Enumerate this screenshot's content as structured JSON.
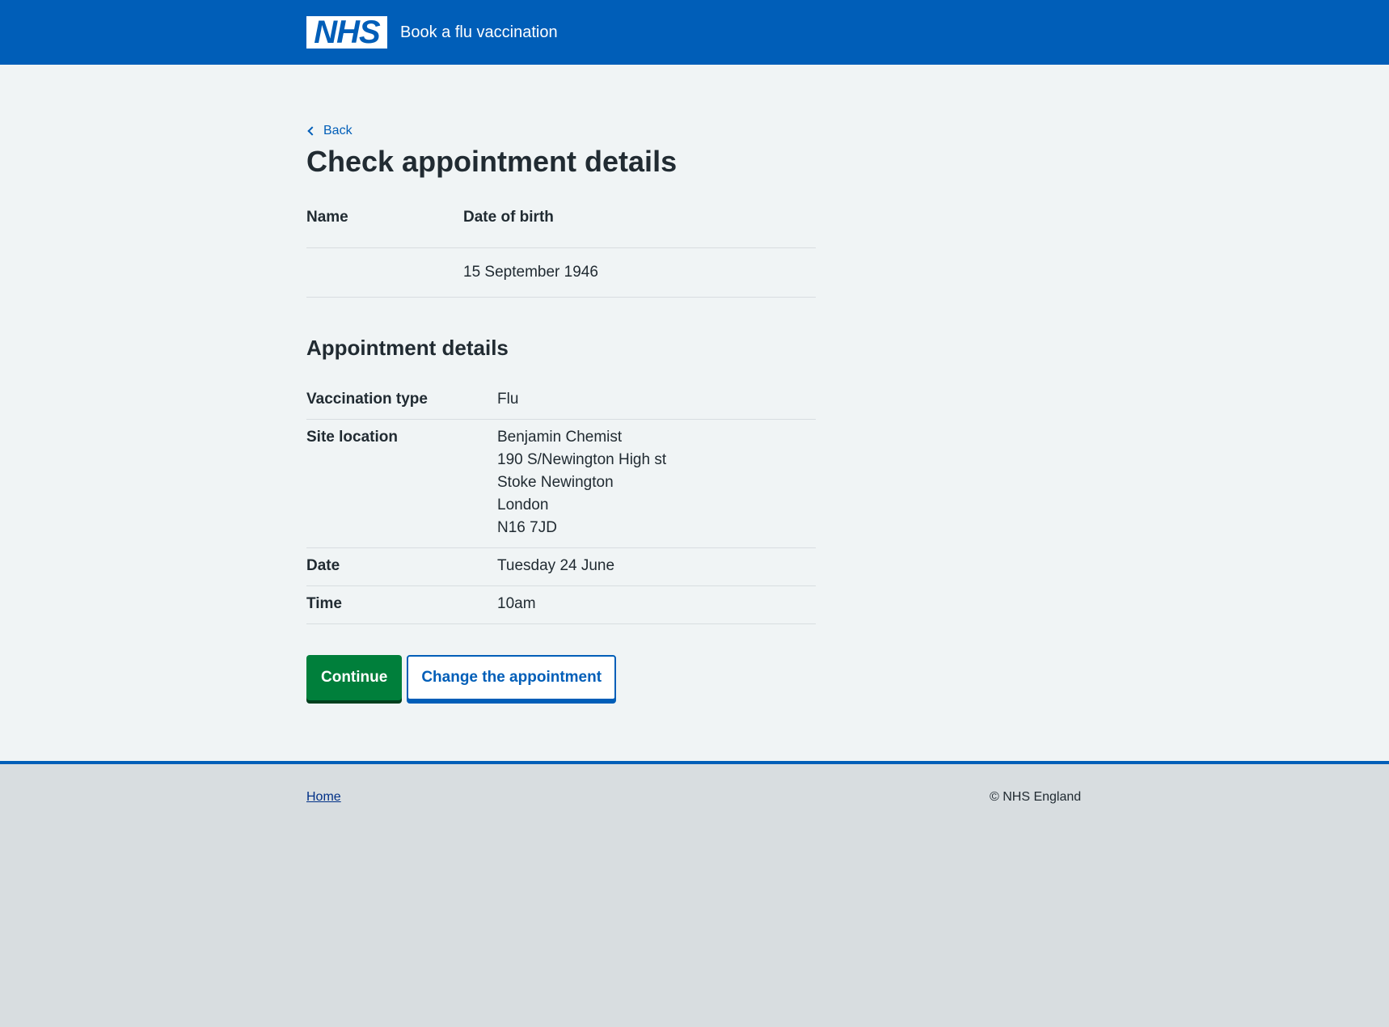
{
  "header": {
    "logo_text": "NHS",
    "service_name": "Book a flu vaccination"
  },
  "nav": {
    "back_label": "Back"
  },
  "page": {
    "title": "Check appointment details"
  },
  "person": {
    "headers": [
      "Name",
      "Date of birth"
    ],
    "name": "",
    "date_of_birth": "15 September 1946"
  },
  "appointment": {
    "heading": "Appointment details",
    "rows": [
      {
        "key": "Vaccination type",
        "value": "Flu"
      },
      {
        "key": "Site location",
        "value_lines": [
          "Benjamin Chemist",
          "190 S/Newington High st",
          "Stoke Newington",
          "London",
          "N16 7JD"
        ]
      },
      {
        "key": "Date",
        "value": "Tuesday 24 June"
      },
      {
        "key": "Time",
        "value": "10am"
      }
    ]
  },
  "actions": {
    "continue_label": "Continue",
    "change_label": "Change the appointment"
  },
  "footer": {
    "home_label": "Home",
    "copyright": "© NHS England"
  },
  "colors": {
    "nhs_blue": "#005eb8",
    "button_green": "#007f3b",
    "main_background": "#f0f4f5",
    "footer_background": "#d8dde0",
    "text": "#212b32"
  }
}
